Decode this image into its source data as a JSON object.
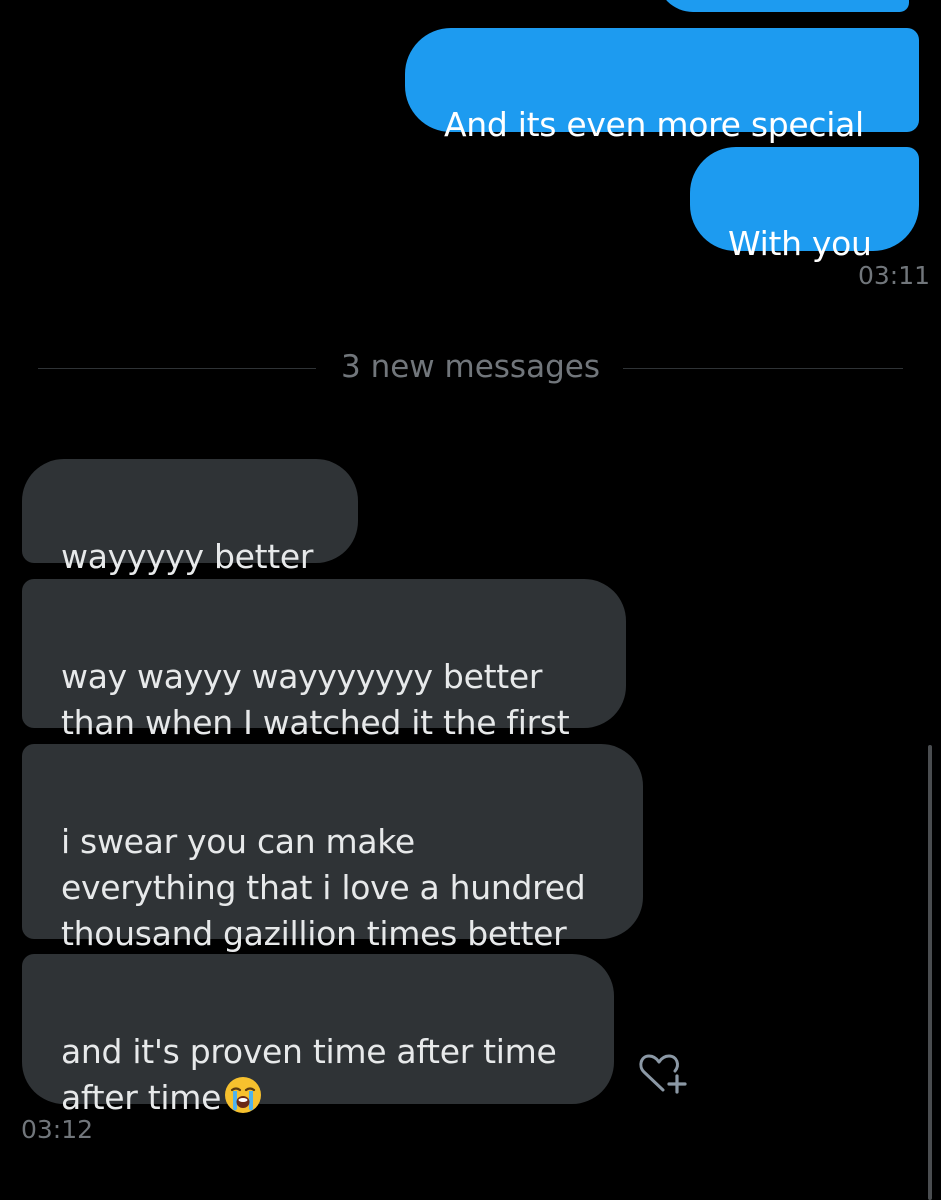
{
  "conversation": {
    "sent_messages": [
      {
        "text": ""
      },
      {
        "text": "And its even more special"
      },
      {
        "text": "With you"
      }
    ],
    "sent_time": "03:11",
    "new_messages_label": "3 new messages",
    "received_messages": [
      {
        "text": "wayyyyy better"
      },
      {
        "text": "way wayyy wayyyyyyy better\nthan when I watched it the first"
      },
      {
        "text": "i swear you can make\neverything that i love a hundred\nthousand gazillion times better"
      },
      {
        "text": "and it's proven time after time\nafter time"
      }
    ],
    "received_time": "03:12",
    "last_message_emoji": "loudly-crying-face",
    "react_icon": "heart-plus-icon"
  },
  "colors": {
    "background": "#000000",
    "sent_bubble": "#1d9bf0",
    "received_bubble": "#2f3336",
    "muted_text": "#71767b"
  }
}
